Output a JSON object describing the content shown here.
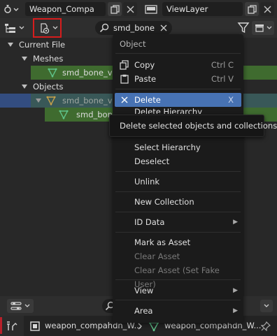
{
  "topbar": {
    "scene_name": "Weapon_Compa",
    "view_layer": "ViewLayer"
  },
  "header": {
    "search_value": "smd_bone"
  },
  "tree": {
    "current_file": "Current File",
    "meshes": "Meshes",
    "mesh_item": "smd_bone_vis",
    "objects": "Objects",
    "object_item": "smd_bone_vis",
    "child_item": "smd_bone"
  },
  "menu": {
    "title": "Object",
    "copy": "Copy",
    "copy_shortcut": "Ctrl C",
    "paste": "Paste",
    "paste_shortcut": "Ctrl V",
    "delete": "Delete",
    "delete_shortcut": "X",
    "delete_hierarchy": "Delete Hierarchy",
    "select_hierarchy": "Select Hierarchy",
    "deselect": "Deselect",
    "unlink": "Unlink",
    "new_collection": "New Collection",
    "id_data": "ID Data",
    "mark_as_asset": "Mark as Asset",
    "clear_asset": "Clear Asset",
    "clear_asset_fake": "Clear Asset (Set Fake User)",
    "view": "View",
    "area": "Area"
  },
  "tooltip": "Delete selected objects and collections.",
  "statusbar": {
    "crumb1": "weapon_compahdn_W...",
    "crumb2": "weapon_compahdn_W..."
  },
  "colors": {
    "selection_blue": "#4772b3",
    "mesh_green": "#5fc38a",
    "highlight_red": "#d61d1d"
  }
}
